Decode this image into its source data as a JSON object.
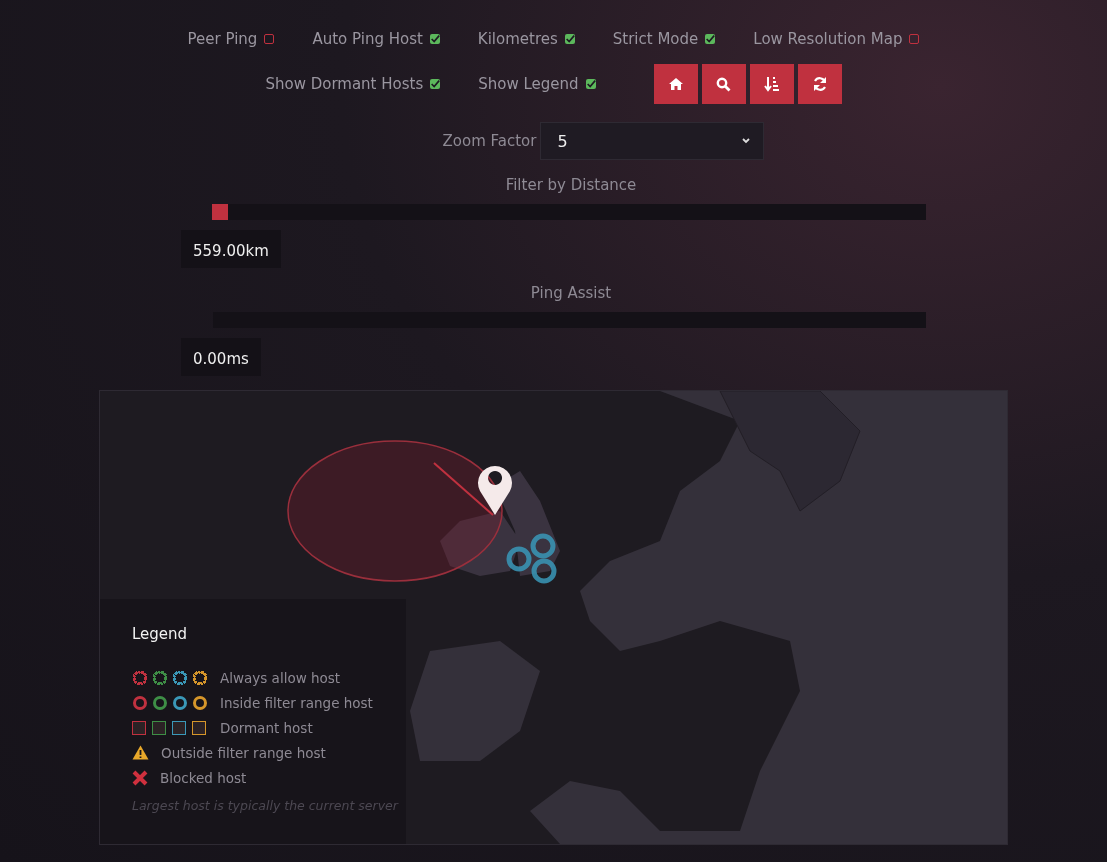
{
  "options": [
    {
      "label": "Peer Ping",
      "checked": false
    },
    {
      "label": "Auto Ping Host",
      "checked": true
    },
    {
      "label": "Kilometres",
      "checked": true
    },
    {
      "label": "Strict Mode",
      "checked": true
    },
    {
      "label": "Low Resolution Map",
      "checked": false
    },
    {
      "label": "Show Dormant Hosts",
      "checked": true
    },
    {
      "label": "Show Legend",
      "checked": true
    }
  ],
  "zoom": {
    "label": "Zoom Factor",
    "value": "5"
  },
  "sliders": [
    {
      "label": "Filter by Distance",
      "level": 0.01,
      "reading": "559.00km"
    },
    {
      "label": "Ping Assist",
      "reading": "0.00ms"
    }
  ],
  "legend": {
    "title": "Legend",
    "rows": [
      {
        "kind": "always",
        "label": "Always allow host",
        "swatches": [
          {
            "color": "#c0313f"
          },
          {
            "color": "#3e8e46"
          },
          {
            "color": "#3a98b8"
          },
          {
            "color": "#d6962a"
          }
        ]
      },
      {
        "kind": "inside",
        "label": "Inside filter range host",
        "swatches": [
          {
            "color": "#c0313f"
          },
          {
            "color": "#3e8e46"
          },
          {
            "color": "#3a98b8"
          },
          {
            "color": "#d6962a"
          }
        ]
      },
      {
        "kind": "dormant",
        "label": "Dormant host",
        "swatches": [
          {
            "color": "#c0313f"
          },
          {
            "color": "#3e8e46"
          },
          {
            "color": "#3a98b8"
          },
          {
            "color": "#d6962a"
          }
        ]
      },
      {
        "kind": "outside",
        "label": "Outside filter range host"
      },
      {
        "kind": "blocked",
        "label": "Blocked host"
      }
    ],
    "note": "Largest host is typically the current server"
  }
}
